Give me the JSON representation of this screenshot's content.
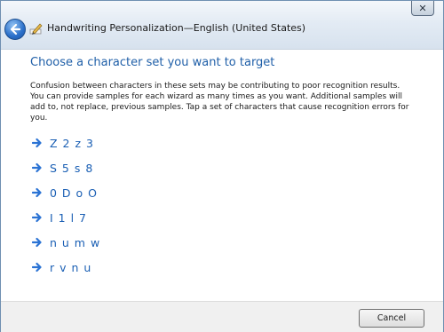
{
  "window": {
    "title": "Handwriting Personalization—English (United States)",
    "close_label": "✕"
  },
  "page": {
    "heading": "Choose a character set you want to target",
    "description": "Confusion between characters in these sets may be contributing to poor recognition results. You can provide samples for each wizard as many times as you want. Additional samples will add to, not replace, previous samples. Tap a set of characters that cause recognition errors for you."
  },
  "options": [
    {
      "label": "Z 2 z 3"
    },
    {
      "label": "S 5 s 8"
    },
    {
      "label": "0 D o O"
    },
    {
      "label": "I 1 l 7"
    },
    {
      "label": "n u m w"
    },
    {
      "label": "r v n u"
    }
  ],
  "footer": {
    "cancel_label": "Cancel"
  },
  "colors": {
    "heading": "#1f5fa8",
    "link": "#1a5fb4",
    "arrow": "#2b73d4"
  }
}
